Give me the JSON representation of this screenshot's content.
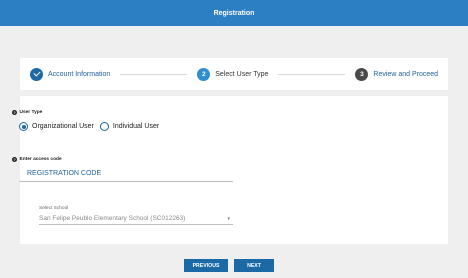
{
  "header": {
    "title": "Registration"
  },
  "steps": [
    {
      "label": "Account Information",
      "state": "done"
    },
    {
      "number": "2",
      "label": "Select User Type",
      "state": "active"
    },
    {
      "number": "3",
      "label": "Review and Proceed",
      "state": "pending"
    }
  ],
  "user_type": {
    "label": "User Type",
    "options": [
      {
        "label": "Organizational User",
        "selected": true
      },
      {
        "label": "Individual User",
        "selected": false
      }
    ]
  },
  "access_code": {
    "label": "Enter access code",
    "value": "REGISTRATION CODE"
  },
  "school": {
    "label": "Select School",
    "value": "San Felipe Peublo Elementary School (SC012263)"
  },
  "buttons": {
    "previous": "PREVIOUS",
    "next": "NEXT"
  },
  "colors": {
    "header_bg": "#2b7fc2",
    "primary": "#1b6aa5",
    "step_pending": "#4a4a4a"
  }
}
